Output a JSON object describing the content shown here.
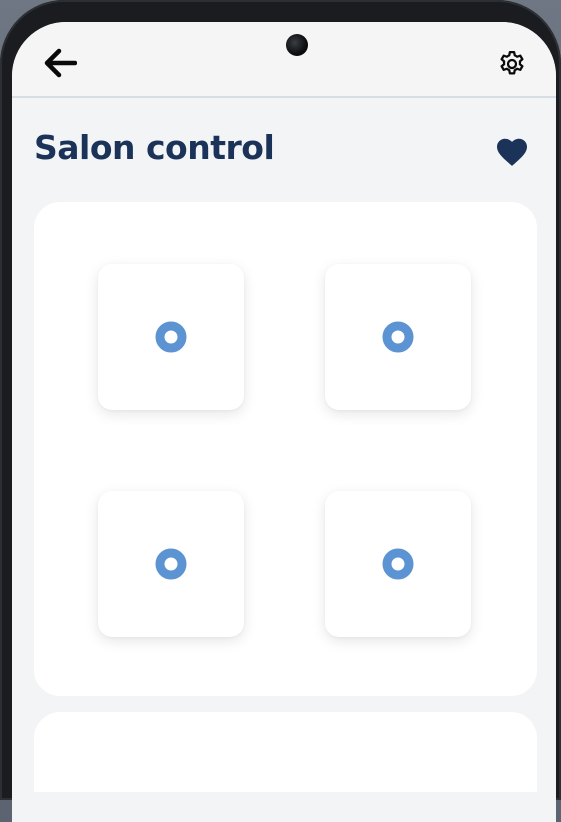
{
  "header": {
    "back_icon": "arrow-left-icon",
    "settings_icon": "gear-icon"
  },
  "page": {
    "title": "Salon control",
    "favorite_icon": "heart-icon"
  },
  "controls": [
    {
      "icon": "ring-indicator-icon"
    },
    {
      "icon": "ring-indicator-icon"
    },
    {
      "icon": "ring-indicator-icon"
    },
    {
      "icon": "ring-indicator-icon"
    }
  ],
  "colors": {
    "title": "#1b3358",
    "accent": "#5b93d3",
    "heart": "#1b3358",
    "background": "#f3f4f5",
    "panel": "#ffffff"
  }
}
